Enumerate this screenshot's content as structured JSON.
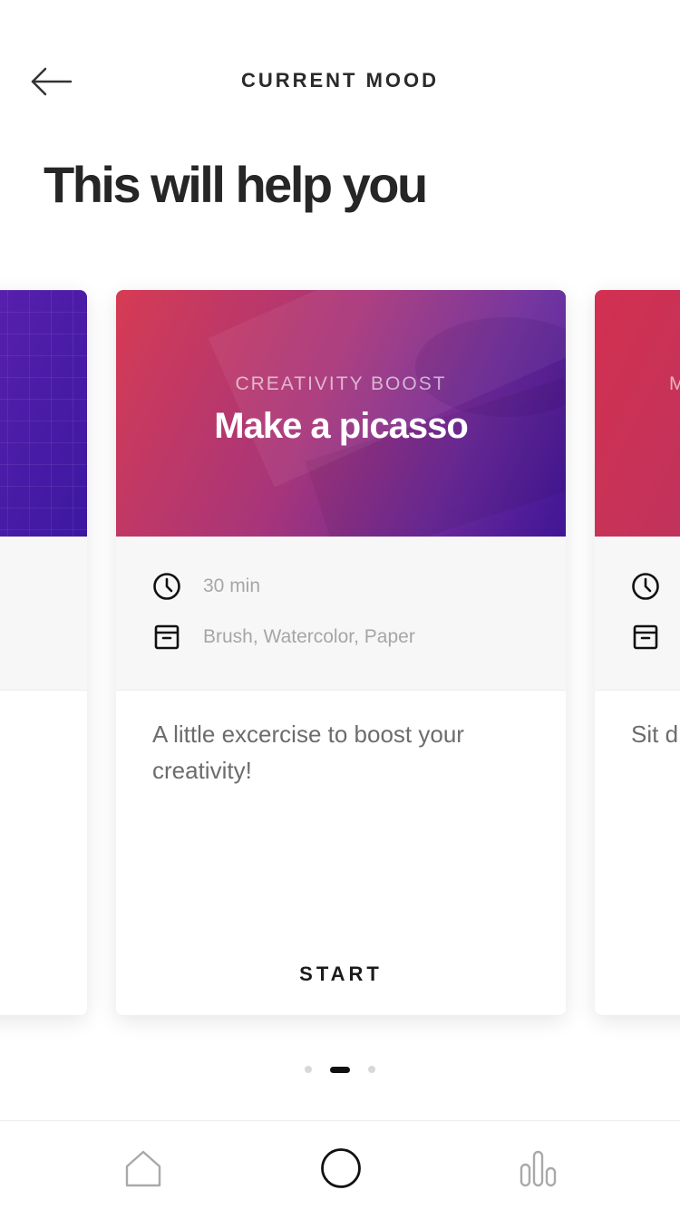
{
  "header": {
    "title": "CURRENT MOOD",
    "back_icon": "arrow-left-icon"
  },
  "heading": "This will help you",
  "cards": [
    {
      "position": "left",
      "kicker": "",
      "title": "",
      "time": "",
      "materials": "",
      "description": "",
      "start_label": ""
    },
    {
      "position": "center",
      "kicker": "CREATIVITY BOOST",
      "title": "Make a picasso",
      "time": "30 min",
      "materials": "Brush, Watercolor, Paper",
      "description": "A little excercise to boost your creativity!",
      "start_label": "START"
    },
    {
      "position": "right",
      "kicker": "M",
      "title": "",
      "time": "",
      "materials": "",
      "description": "Sit d",
      "start_label": ""
    }
  ],
  "pagination": {
    "total": 3,
    "active_index": 1
  },
  "tabbar": {
    "items": [
      "home-icon",
      "circle-icon",
      "stats-icon"
    ],
    "active": "circle-icon"
  },
  "colors": {
    "hero_gradient_start": "#d63b53",
    "hero_gradient_end": "#3f1596",
    "text_dark": "#262626",
    "text_muted": "#a6a6a6"
  }
}
